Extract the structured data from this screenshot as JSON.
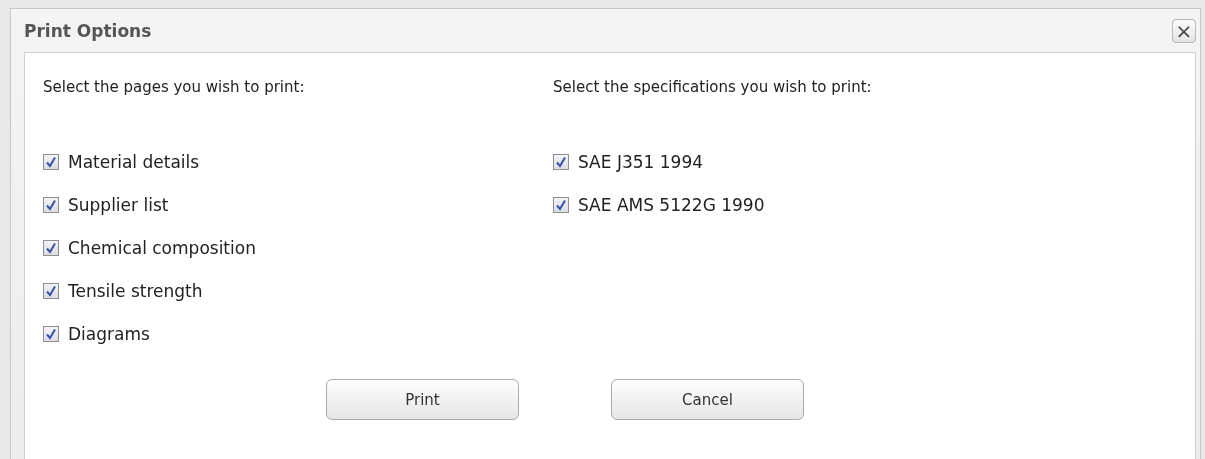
{
  "dialog": {
    "title": "Print Options",
    "close_label": "×"
  },
  "pages": {
    "heading": "Select the pages you wish to print:",
    "items": [
      {
        "label": "Material details",
        "checked": true
      },
      {
        "label": "Supplier list",
        "checked": true
      },
      {
        "label": "Chemical composition",
        "checked": true
      },
      {
        "label": "Tensile strength",
        "checked": true
      },
      {
        "label": "Diagrams",
        "checked": true
      }
    ]
  },
  "specifications": {
    "heading": "Select the specifications you wish to print:",
    "items": [
      {
        "label": "SAE J351 1994",
        "checked": true
      },
      {
        "label": "SAE AMS 5122G 1990",
        "checked": true
      }
    ]
  },
  "buttons": [
    {
      "label": "Print"
    },
    {
      "label": "Cancel"
    }
  ]
}
